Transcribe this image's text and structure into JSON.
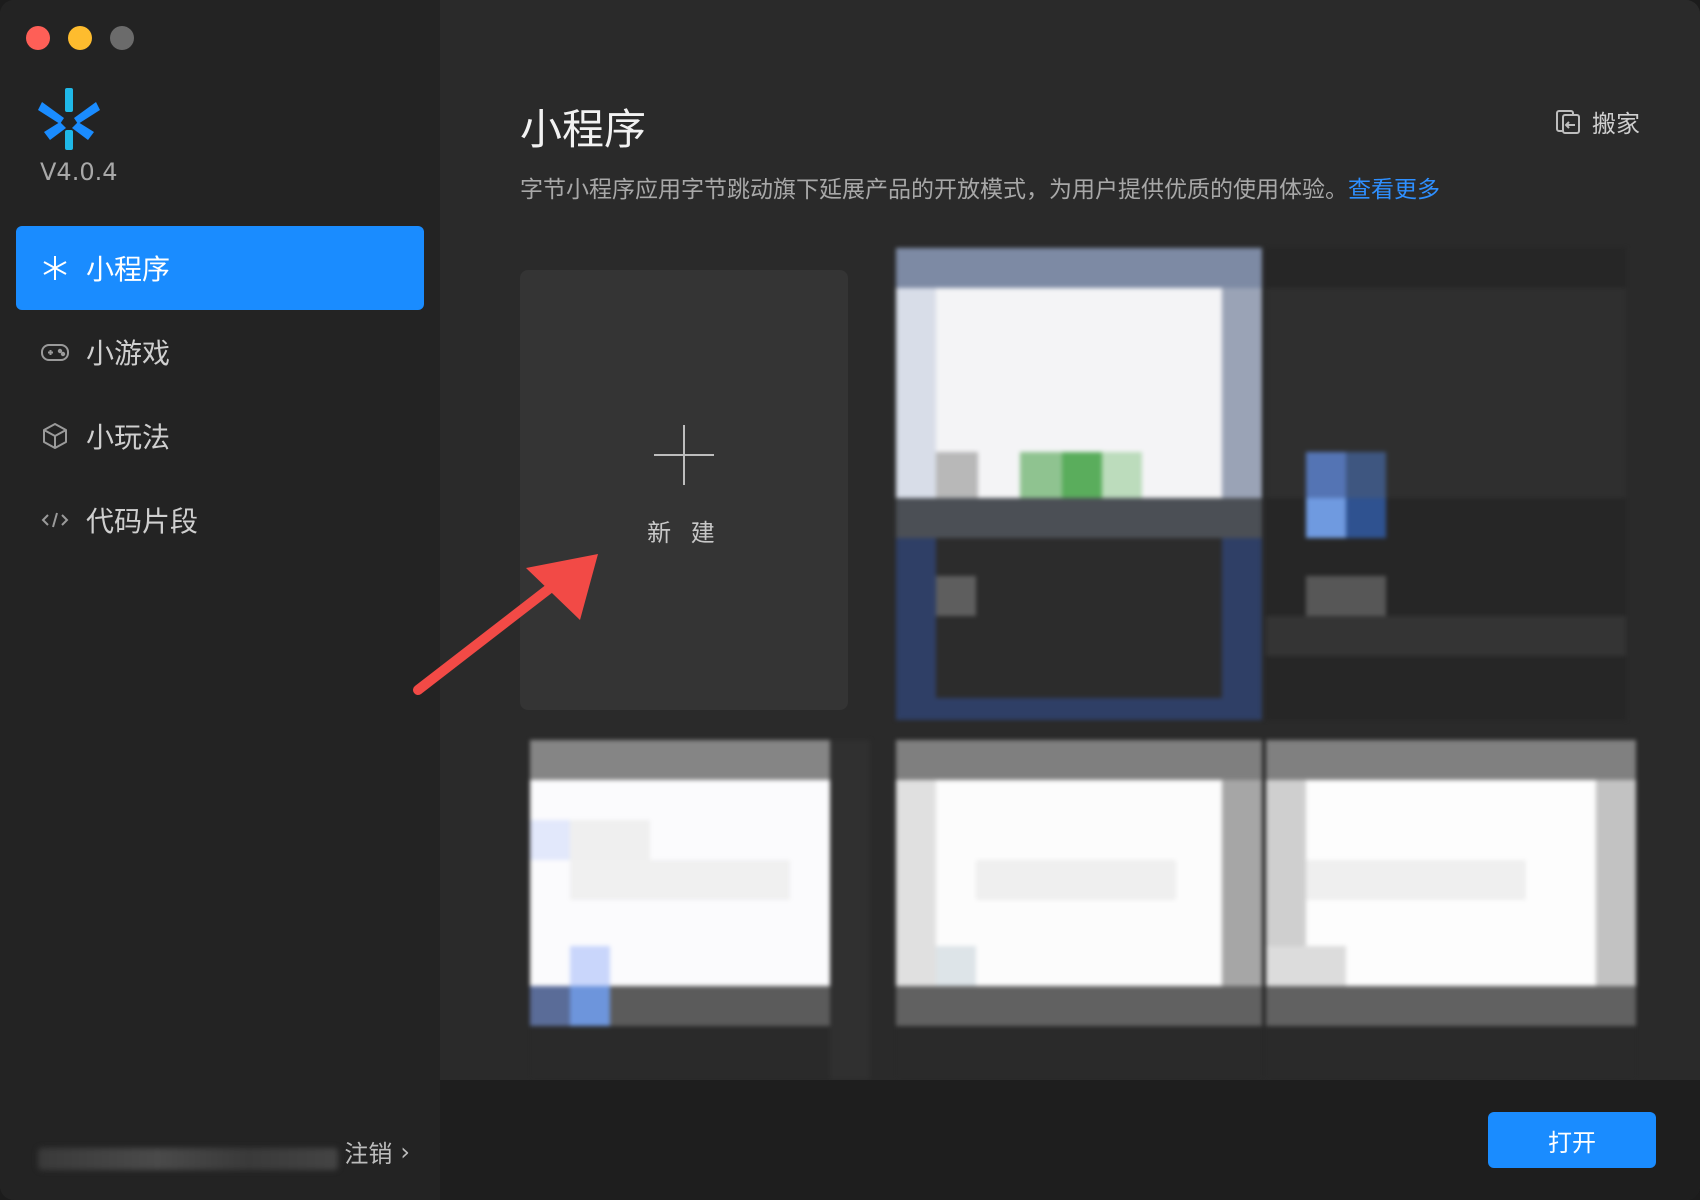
{
  "sidebar": {
    "version": "V4.0.4",
    "items": [
      {
        "label": "小程序",
        "icon": "asterisk-icon",
        "active": true
      },
      {
        "label": "小游戏",
        "icon": "gamepad-icon",
        "active": false
      },
      {
        "label": "小玩法",
        "icon": "cube-icon",
        "active": false
      },
      {
        "label": "代码片段",
        "icon": "code-icon",
        "active": false
      }
    ],
    "logout_label": "注销",
    "logout_chevron": "›"
  },
  "main": {
    "title": "小程序",
    "move_label": "搬家",
    "description": "字节小程序应用字节跳动旗下延展产品的开放模式，为用户提供优质的使用体验。",
    "more_link": "查看更多",
    "new_label": "新 建",
    "open_button": "打开"
  },
  "colors": {
    "accent": "#1a8cff",
    "link": "#2e8fff",
    "arrow": "#f24a46"
  }
}
